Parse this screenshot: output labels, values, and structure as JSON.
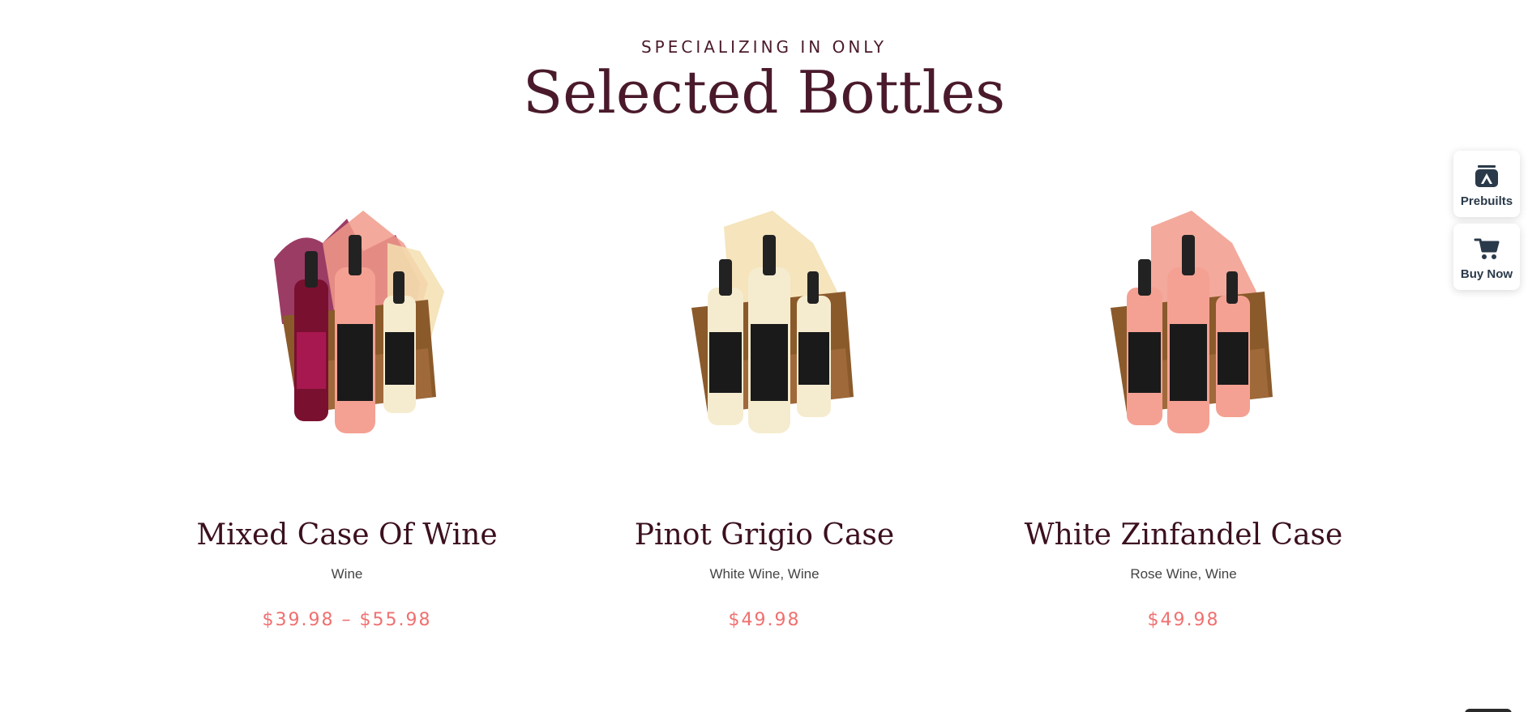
{
  "header": {
    "eyebrow": "SPECIALIZING IN ONLY",
    "title": "Selected Bottles"
  },
  "products": [
    {
      "name": "Mixed Case Of Wine",
      "categories": "Wine",
      "price": "$39.98 – $55.98",
      "bottle_colors": [
        "#7a1030",
        "#f4a193",
        "#f5ecd0"
      ],
      "splash_colors": [
        "#8a1a4a",
        "#f19a8a",
        "#f3dfb0"
      ]
    },
    {
      "name": "Pinot Grigio Case",
      "categories": "White Wine, Wine",
      "price": "$49.98",
      "bottle_colors": [
        "#f5ecd0",
        "#f5ecd0",
        "#f5ecd0"
      ],
      "splash_colors": [
        "#f3dfb0",
        "#f3e6c4",
        "#f6ead0"
      ]
    },
    {
      "name": "White Zinfandel Case",
      "categories": "Rose Wine, Wine",
      "price": "$49.98",
      "bottle_colors": [
        "#f4a193",
        "#f4a193",
        "#f4a193"
      ],
      "splash_colors": [
        "#f19a8a",
        "#f2a59a",
        "#f4b0a4"
      ]
    }
  ],
  "floating": {
    "prebuilts_label": "Prebuilts",
    "buy_now_label": "Buy Now"
  },
  "colors": {
    "heading": "#4a1a2c",
    "price": "#f07070",
    "float_icon": "#2a3a4a"
  }
}
